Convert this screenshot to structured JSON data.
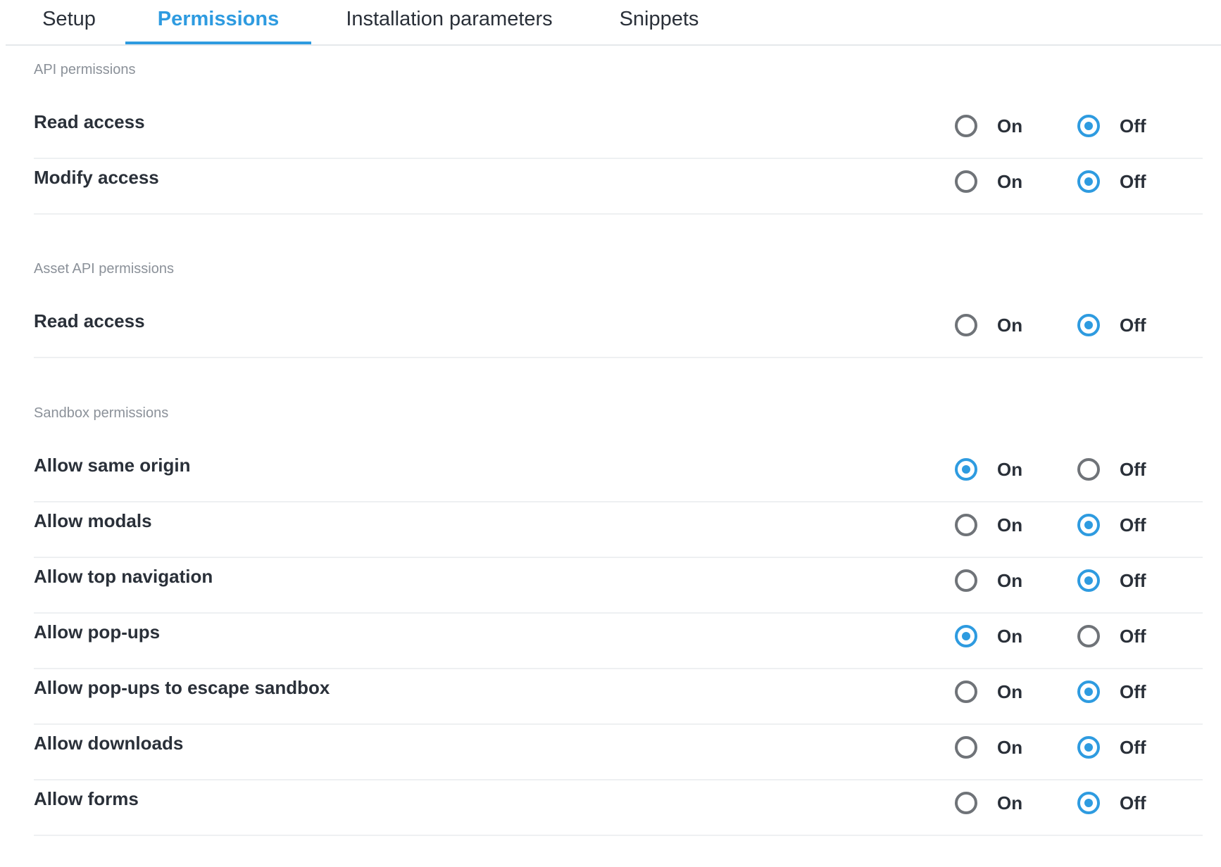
{
  "tabs": [
    {
      "label": "Setup",
      "active": false
    },
    {
      "label": "Permissions",
      "active": true
    },
    {
      "label": "Installation parameters",
      "active": false
    },
    {
      "label": "Snippets",
      "active": false
    }
  ],
  "accent_color": "#2e9be0",
  "on_label": "On",
  "off_label": "Off",
  "sections": [
    {
      "title": "API permissions",
      "rows": [
        {
          "label": "Read access",
          "value": "Off"
        },
        {
          "label": "Modify access",
          "value": "Off"
        }
      ]
    },
    {
      "title": "Asset API permissions",
      "rows": [
        {
          "label": "Read access",
          "value": "Off"
        }
      ]
    },
    {
      "title": "Sandbox permissions",
      "rows": [
        {
          "label": "Allow same origin",
          "value": "On"
        },
        {
          "label": "Allow modals",
          "value": "Off"
        },
        {
          "label": "Allow top navigation",
          "value": "Off"
        },
        {
          "label": "Allow pop-ups",
          "value": "On"
        },
        {
          "label": "Allow pop-ups to escape sandbox",
          "value": "Off"
        },
        {
          "label": "Allow downloads",
          "value": "Off"
        },
        {
          "label": "Allow forms",
          "value": "Off"
        }
      ]
    }
  ]
}
